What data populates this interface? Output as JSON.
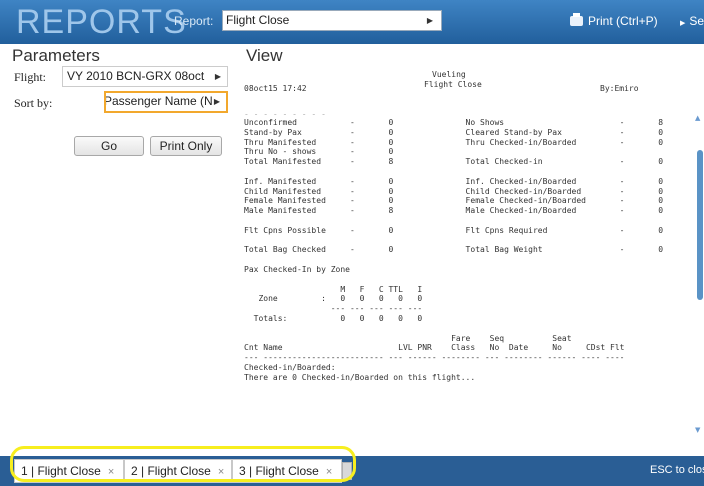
{
  "app": {
    "title": "REPORTS"
  },
  "header": {
    "report_label": "Report:",
    "report_value": "Flight Close",
    "print_label": "Print (Ctrl+P)",
    "settings_label": "Se"
  },
  "params": {
    "title": "Parameters",
    "flight_label": "Flight:",
    "flight_value": "VY 2010 BCN-GRX 08oct",
    "sort_label": "Sort by:",
    "sort_value": "Passenger Name (N)",
    "go_label": "Go",
    "print_only_label": "Print Only"
  },
  "view": {
    "title": "View",
    "report_header": {
      "datetime": "08oct15 17:42",
      "airline": "Vueling",
      "report_name": "Flight Close",
      "by": "By:Emiro"
    },
    "lines": [
      "Unconfirmed           -       0               No Shows                        -       8",
      "Stand-by Pax          -       0               Cleared Stand-by Pax            -       0",
      "Thru Manifested       -       0               Thru Checked-in/Boarded         -       0",
      "Thru No - shows       -       0",
      "Total Manifested      -       8               Total Checked-in                -       0",
      "",
      "Inf. Manifested       -       0               Inf. Checked-in/Boarded         -       0",
      "Child Manifested      -       0               Child Checked-in/Boarded        -       0",
      "Female Manifested     -       0               Female Checked-in/Boarded       -       0",
      "Male Manifested       -       8               Male Checked-in/Boarded         -       0",
      "",
      "Flt Cpns Possible     -       0               Flt Cpns Required               -       0",
      "",
      "Total Bag Checked     -       0               Total Bag Weight                -       0",
      "",
      "Pax Checked-In by Zone",
      "",
      "                    M   F   C TTL   I",
      "   Zone         :   0   0   0   0   0",
      "                  --- --- --- --- ---",
      "  Totals:           0   0   0   0   0",
      "",
      "                                           Fare    Seq          Seat",
      "Cnt Name                        LVL PNR    Class   No  Date     No     CDst Flt",
      "--- ------------------------- --- ------ -------- --- -------- ------ ---- ----",
      "Checked-in/Boarded:",
      "There are 0 Checked-in/Boarded on this flight..."
    ]
  },
  "tabs": [
    {
      "label": "1 | Flight Close",
      "close": "×"
    },
    {
      "label": "2 | Flight Close",
      "close": "×"
    },
    {
      "label": "3 | Flight Close",
      "close": "×"
    }
  ],
  "footer": {
    "esc_text": "ESC to close"
  },
  "colors": {
    "topbar": "#215f9c",
    "bottombar": "#2a5e95",
    "highlight_orange": "#f2a82d",
    "highlight_yellow": "#f7ee1f"
  }
}
